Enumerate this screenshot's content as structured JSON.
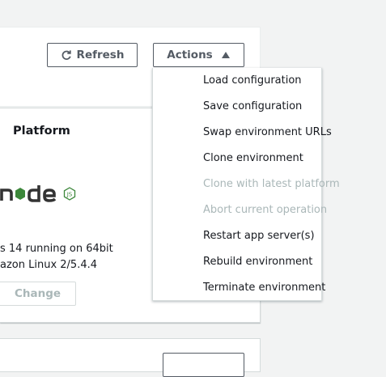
{
  "header": {
    "refresh_label": "Refresh",
    "actions_label": "Actions"
  },
  "platform": {
    "title": "Platform",
    "logo_name": "node-js-logo",
    "description_line1": "s 14 running on 64bit",
    "description_line2": "azon Linux 2/5.4.4",
    "change_label": "Change"
  },
  "actions_menu": {
    "items": [
      {
        "label": "Load configuration",
        "disabled": false
      },
      {
        "label": "Save configuration",
        "disabled": false
      },
      {
        "label": "Swap environment URLs",
        "disabled": false
      },
      {
        "label": "Clone environment",
        "disabled": false
      },
      {
        "label": "Clone with latest platform",
        "disabled": true
      },
      {
        "label": "Abort current operation",
        "disabled": true
      },
      {
        "label": "Restart app server(s)",
        "disabled": false
      },
      {
        "label": "Rebuild environment",
        "disabled": false
      },
      {
        "label": "Terminate environment",
        "disabled": false
      }
    ]
  },
  "colors": {
    "background": "#f2f3f3",
    "panel": "#ffffff",
    "text": "#16191f",
    "button_border": "#545b64",
    "disabled_text": "#aab7b8",
    "node_green": "#3c873a"
  }
}
